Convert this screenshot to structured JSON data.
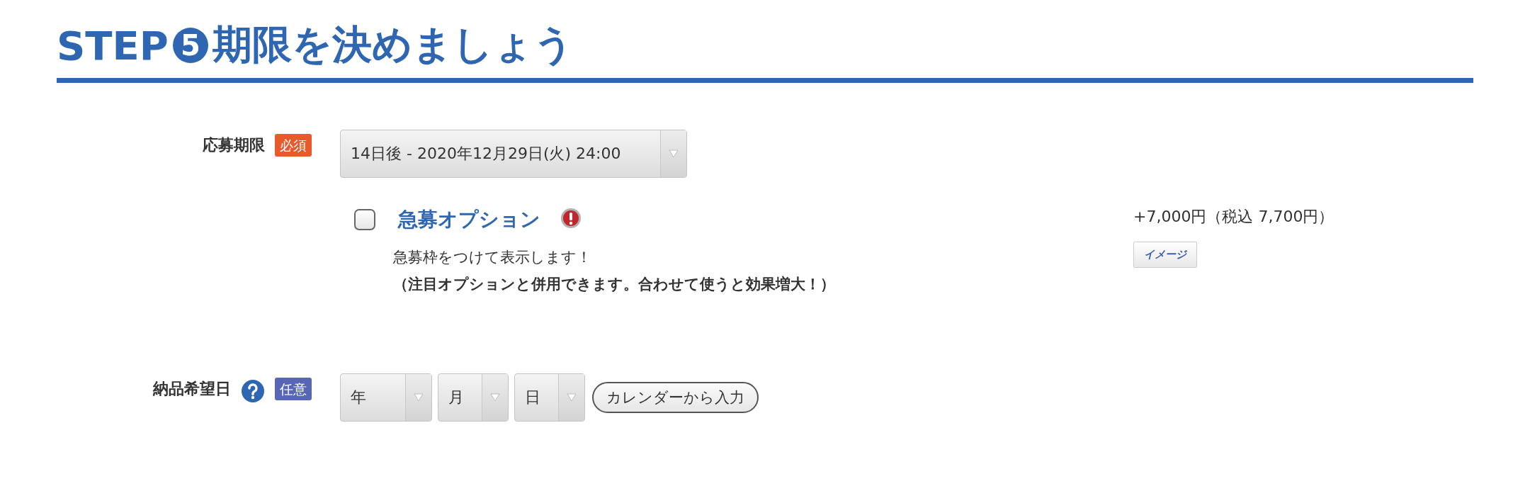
{
  "heading": {
    "step": "STEP",
    "number": "5",
    "title": "期限を決めましょう"
  },
  "deadline": {
    "label": "応募期限",
    "badge": {
      "kind": "required",
      "text": "必須"
    },
    "select": {
      "value": "14日後 - 2020年12月29日(火) 24:00"
    }
  },
  "urgent_option": {
    "checked": false,
    "title": "急募オプション",
    "description": "急募枠をつけて表示します！",
    "note": "（注目オプションと併用できます。合わせて使うと効果増大！）",
    "price": "+7,000円（税込 7,700円）",
    "image_button": "イメージ"
  },
  "delivery_date": {
    "label": "納品希望日",
    "badge": {
      "kind": "optional",
      "text": "任意"
    },
    "selects": [
      {
        "value": "年"
      },
      {
        "value": "月"
      },
      {
        "value": "日"
      }
    ],
    "calendar_button": "カレンダーから入力"
  }
}
